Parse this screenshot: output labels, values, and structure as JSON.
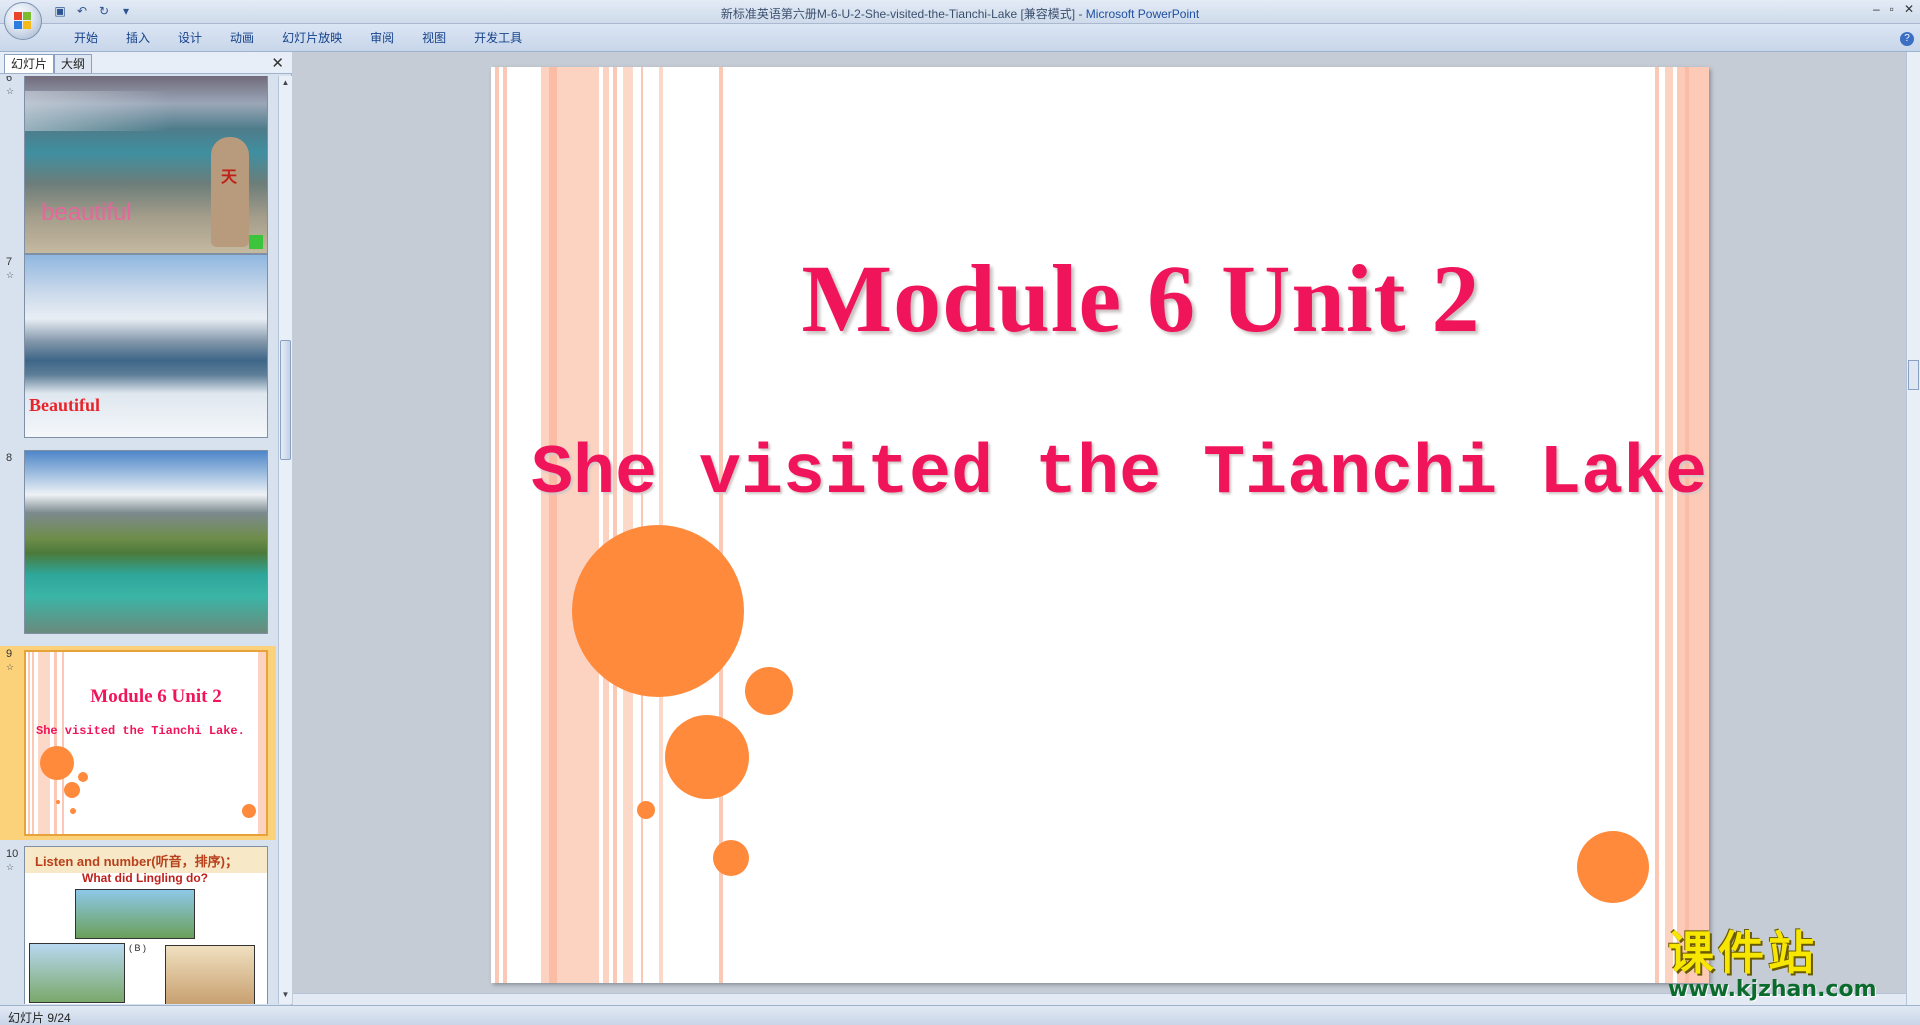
{
  "window": {
    "title": "新标准英语第六册M-6-U-2-She-visited-the-Tianchi-Lake [兼容模式] - ",
    "app_name": "Microsoft PowerPoint",
    "controls": [
      "–",
      "▫",
      "✕"
    ]
  },
  "ribbon": {
    "tabs": [
      "开始",
      "插入",
      "设计",
      "动画",
      "幻灯片放映",
      "审阅",
      "视图",
      "开发工具"
    ]
  },
  "left_pane": {
    "tabs": [
      "幻灯片",
      "大纲"
    ],
    "close": "✕",
    "thumbnails": [
      {
        "number": "6",
        "caption": "beautiful"
      },
      {
        "number": "7",
        "caption": "Beautiful"
      },
      {
        "number": "8",
        "caption": ""
      },
      {
        "number": "9",
        "title": "Module 6 Unit 2",
        "subtitle": "She visited the Tianchi Lake."
      },
      {
        "number": "10",
        "title": "Listen and number(听音，排序)；",
        "subtitle": "What did Lingling do?",
        "label": "( B )"
      }
    ]
  },
  "slide": {
    "title": "Module 6 Unit 2",
    "subtitle": "She visited the Tianchi Lake."
  },
  "status": {
    "slide_counter": "幻灯片 9/24"
  },
  "watermark": {
    "cn": "课件站",
    "url": "www.kjzhan.com"
  },
  "colors": {
    "accent_pink": "#f0145a",
    "circle_orange": "#ff8a3c",
    "stripe_peach": "#fcd2c0"
  }
}
